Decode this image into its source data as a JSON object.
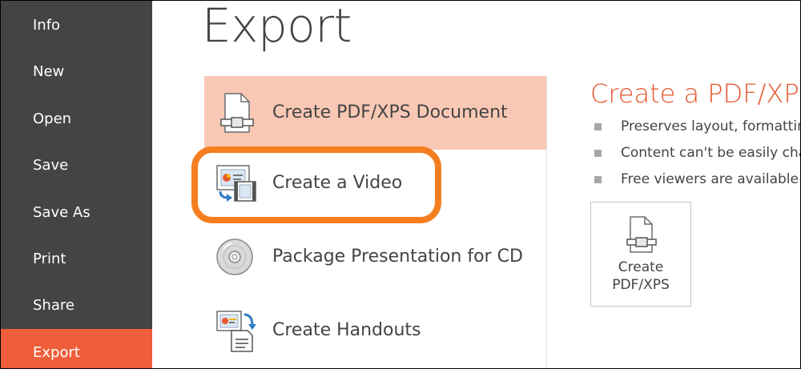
{
  "sidebar": {
    "items": [
      {
        "label": "Info"
      },
      {
        "label": "New"
      },
      {
        "label": "Open"
      },
      {
        "label": "Save"
      },
      {
        "label": "Save As"
      },
      {
        "label": "Print"
      },
      {
        "label": "Share"
      },
      {
        "label": "Export"
      }
    ],
    "active_index": 7
  },
  "page": {
    "title": "Export"
  },
  "options": [
    {
      "label": "Create PDF/XPS Document",
      "icon": "pdf-document-icon",
      "selected": true
    },
    {
      "label": "Create a Video",
      "icon": "video-icon",
      "selected": false
    },
    {
      "label": "Package Presentation for CD",
      "icon": "cd-icon",
      "selected": false
    },
    {
      "label": "Create Handouts",
      "icon": "handouts-icon",
      "selected": false
    }
  ],
  "detail": {
    "title": "Create a PDF/XPS",
    "bullets": [
      "Preserves layout, formatting",
      "Content can't be easily chan",
      "Free viewers are available o"
    ],
    "button": {
      "line1": "Create",
      "line2": "PDF/XPS"
    }
  },
  "colors": {
    "sidebar_bg": "#444444",
    "sidebar_active": "#f05d3a",
    "selected_option_bg": "#f9c8b4",
    "highlight_ring": "#f57f20",
    "detail_title": "#e4572e"
  }
}
